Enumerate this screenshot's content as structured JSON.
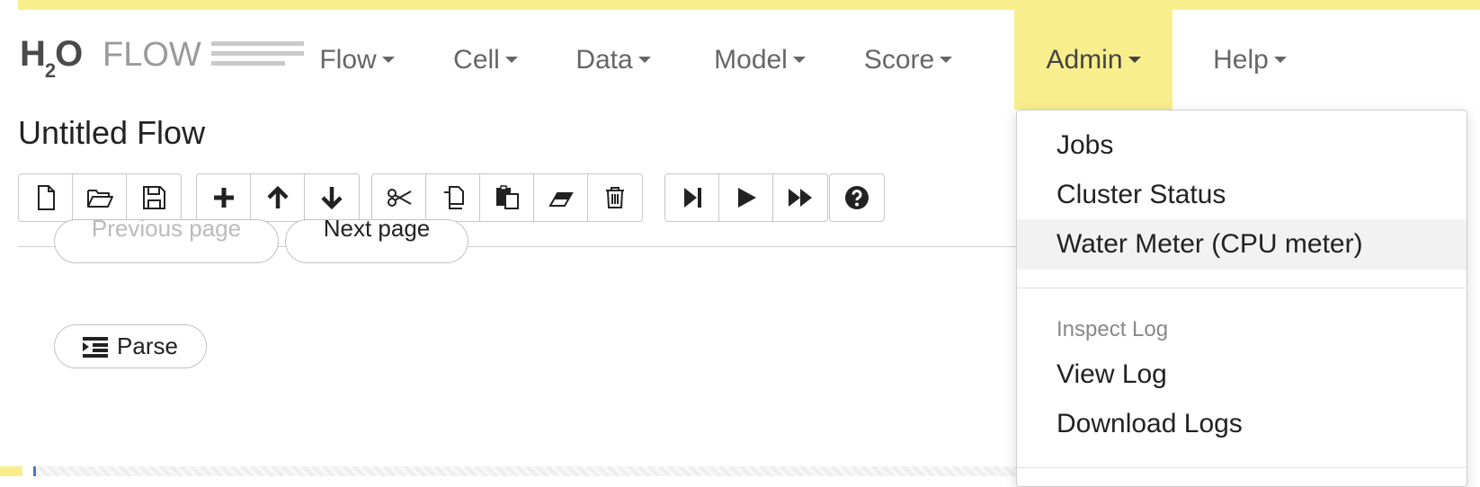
{
  "logo": {
    "h2o_text": "H",
    "h2o_sub": "2",
    "h2o_o": "O",
    "flow_text": "FLOW"
  },
  "menu": {
    "items": [
      {
        "label": "Flow"
      },
      {
        "label": "Cell"
      },
      {
        "label": "Data"
      },
      {
        "label": "Model"
      },
      {
        "label": "Score"
      },
      {
        "label": "Admin"
      },
      {
        "label": "Help"
      }
    ],
    "active": "Admin",
    "accent_color": "#f8ee8d"
  },
  "page": {
    "title": "Untitled Flow"
  },
  "toolbar": {
    "groups": [
      [
        "new-file-icon",
        "open-folder-icon",
        "save-icon"
      ],
      [
        "plus-icon",
        "arrow-up-icon",
        "arrow-down-icon"
      ],
      [
        "scissors-icon",
        "copy-icon",
        "paste-icon",
        "eraser-icon",
        "trash-icon"
      ],
      [
        "step-forward-icon",
        "play-icon",
        "fast-forward-icon"
      ],
      [
        "help-icon"
      ]
    ]
  },
  "cell": {
    "previous_page": "Previous page",
    "next_page": "Next page",
    "parse_label": "Parse"
  },
  "admin_menu": {
    "items": [
      {
        "label": "Jobs"
      },
      {
        "label": "Cluster Status"
      },
      {
        "label": "Water Meter (CPU meter)"
      }
    ],
    "log_header": "Inspect Log",
    "log_items": [
      {
        "label": "View Log"
      },
      {
        "label": "Download Logs"
      }
    ]
  }
}
